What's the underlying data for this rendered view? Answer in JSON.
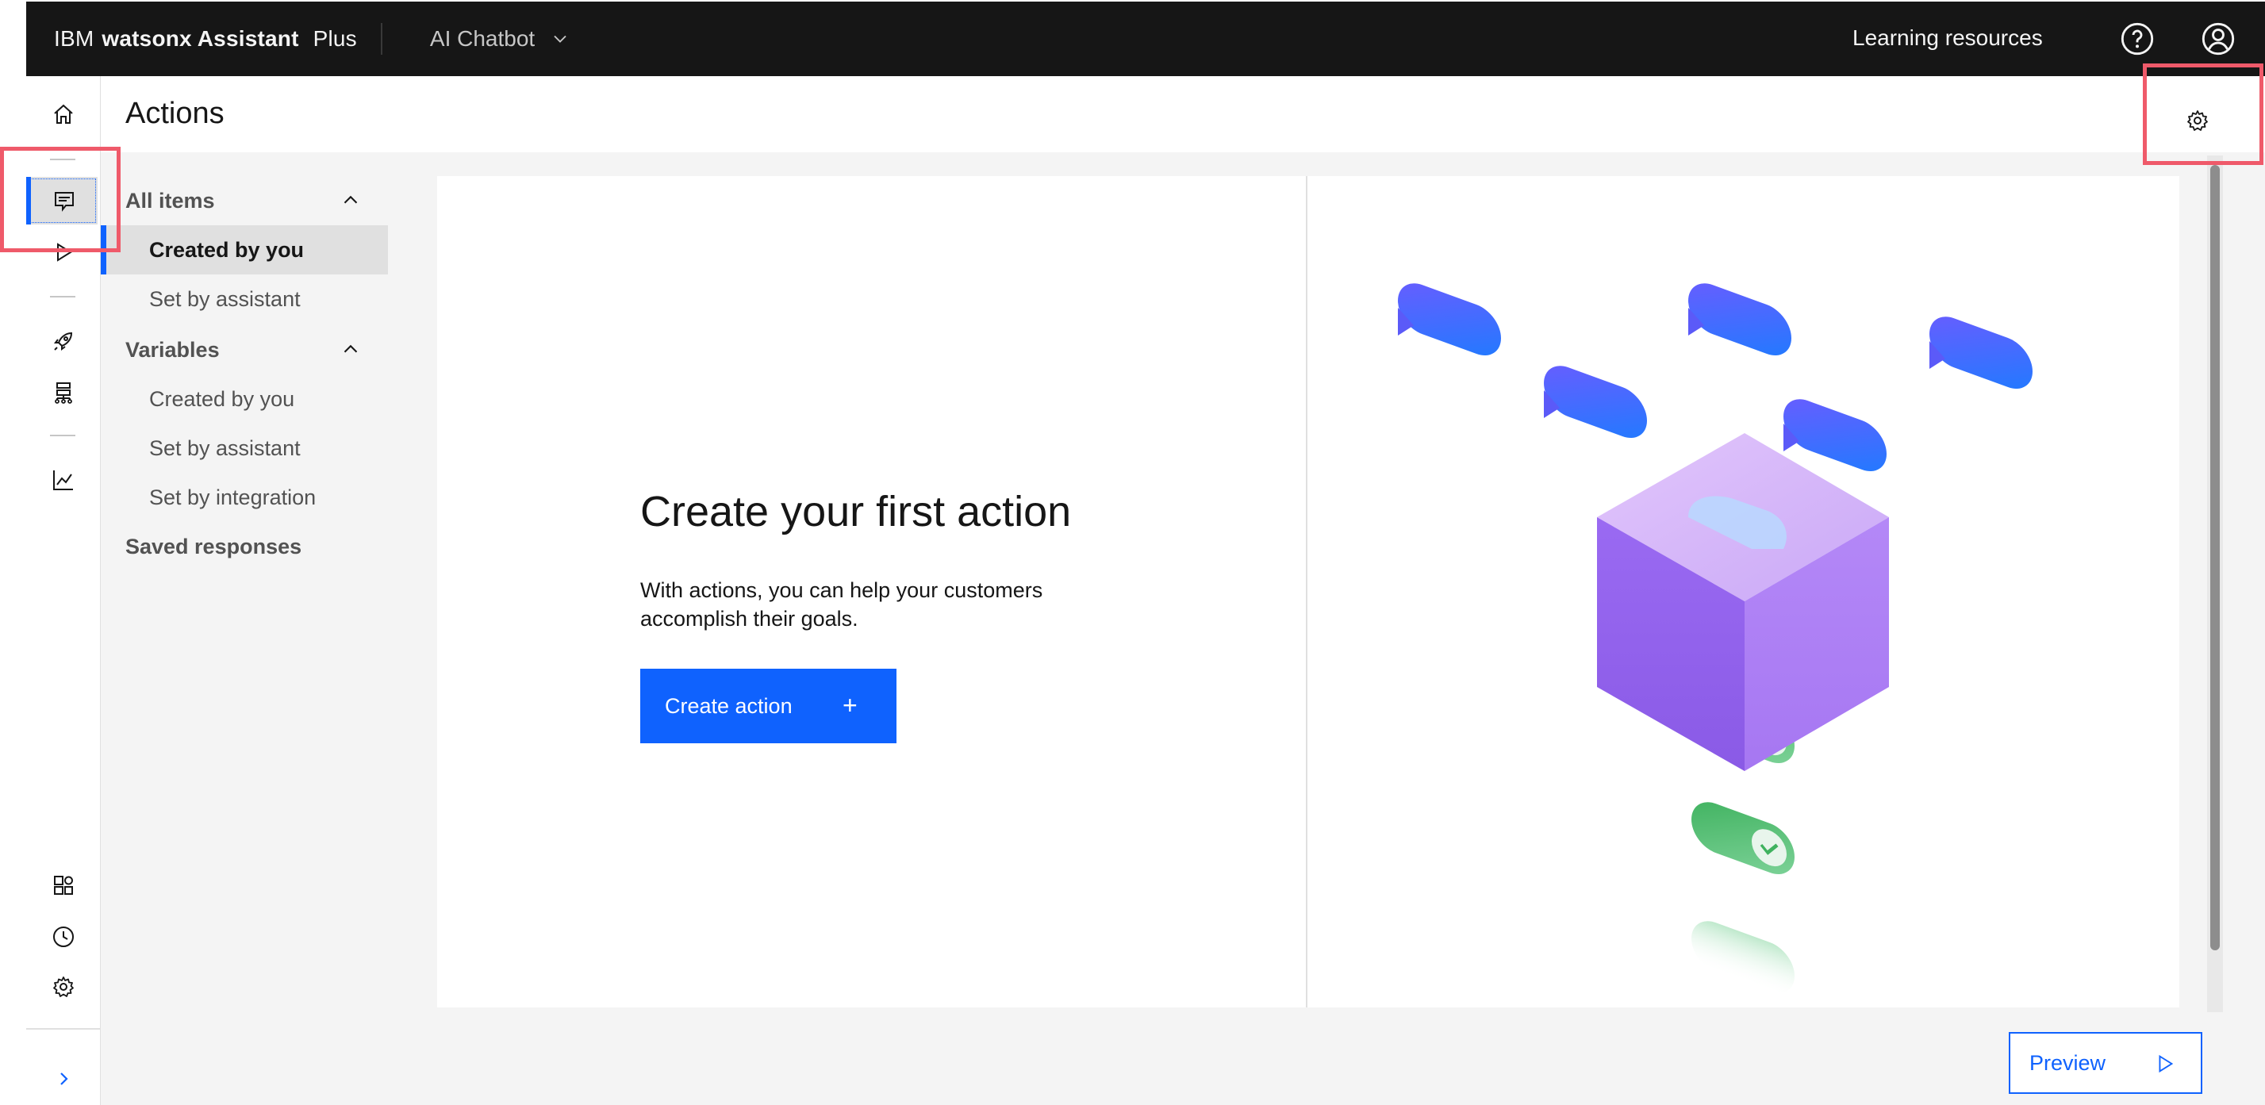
{
  "header": {
    "brand_prefix": "IBM",
    "brand_name": "watsonx Assistant",
    "brand_plan": "Plus",
    "assistant_name": "AI Chatbot",
    "learning_resources": "Learning resources"
  },
  "page": {
    "title": "Actions"
  },
  "subnav": {
    "all_items": "All items",
    "all_items_children": [
      "Created by you",
      "Set by assistant"
    ],
    "variables": "Variables",
    "variables_children": [
      "Created by you",
      "Set by assistant",
      "Set by integration"
    ],
    "saved_responses": "Saved responses"
  },
  "empty_state": {
    "title": "Create your first action",
    "description": "With actions, you can help your customers accomplish their goals.",
    "create_button": "Create action",
    "create_button_icon": "+"
  },
  "preview_button": "Preview",
  "colors": {
    "header_bg": "#161616",
    "accent": "#0f62fe",
    "highlight": "#ef5a6a"
  },
  "icons": [
    "home-icon",
    "chat-icon",
    "play-icon",
    "rocket-icon",
    "flow-icon",
    "analytics-icon",
    "apps-icon",
    "history-icon",
    "gear-icon",
    "help-icon",
    "user-icon",
    "chevron-right-icon"
  ]
}
